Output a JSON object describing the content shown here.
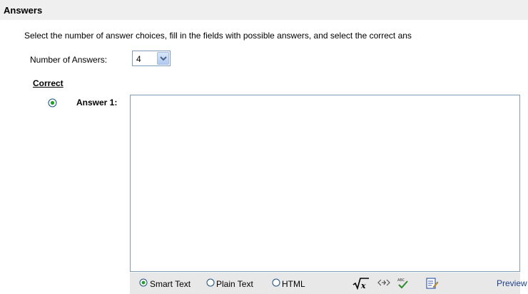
{
  "section": {
    "title": "Answers"
  },
  "instructions": "Select the number of answer choices, fill in the fields with possible answers, and select the correct ans",
  "num_answers": {
    "label": "Number of Answers:",
    "value": "4"
  },
  "answers_table": {
    "correct_header": "Correct",
    "answers": [
      {
        "label": "Answer 1:",
        "correct": true,
        "text": ""
      }
    ]
  },
  "editor_toolbar": {
    "format_options": [
      {
        "label": "Smart Text",
        "selected": true
      },
      {
        "label": "Plain Text",
        "selected": false
      },
      {
        "label": "HTML",
        "selected": false
      }
    ],
    "tools": [
      "math-equation-icon",
      "insert-link-icon",
      "spell-check-icon",
      "preview-icon"
    ],
    "preview_label": "Preview"
  }
}
